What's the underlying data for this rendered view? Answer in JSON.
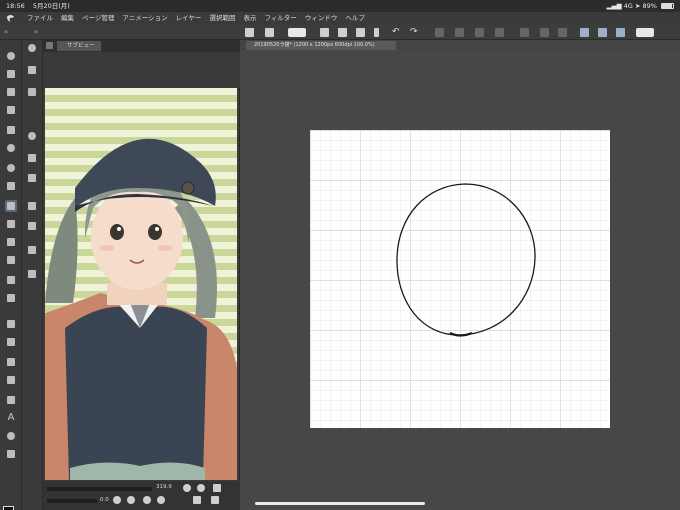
{
  "status_bar": {
    "time": "18:56",
    "date": "5月20日(月)",
    "network": "4G",
    "battery": "89%"
  },
  "menu": {
    "items": [
      "ファイル",
      "編集",
      "ページ管理",
      "アニメーション",
      "レイヤー",
      "選択範囲",
      "表示",
      "フィルター",
      "ウィンドウ",
      "ヘルプ"
    ]
  },
  "subview": {
    "title": "サブビュー",
    "zoom": "319.9",
    "rotation": "0.0"
  },
  "canvas": {
    "tab_title": "20190520ラ描* (1200 x 1200px 600dpi 100.0%)"
  },
  "colors": {
    "accent": "#5a6b80",
    "background": "#474747"
  }
}
